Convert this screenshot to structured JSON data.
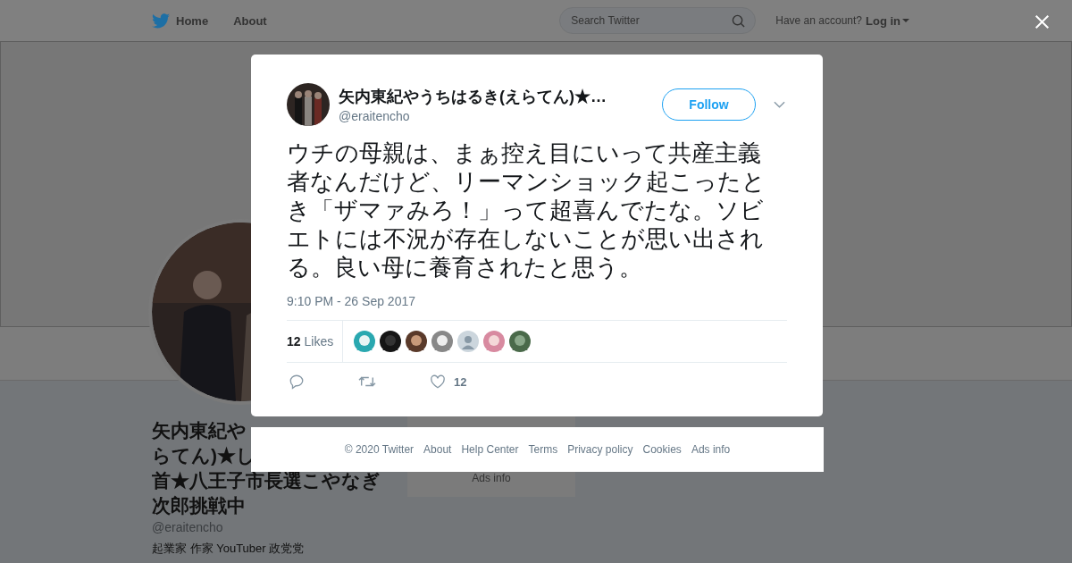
{
  "topbar": {
    "nav": [
      {
        "label": "Home"
      },
      {
        "label": "About"
      }
    ],
    "search": {
      "placeholder": "Search Twitter"
    },
    "account_prompt": "Have an account?",
    "login": "Log in"
  },
  "profile": {
    "name_lines": [
      "矢内東紀や",
      "らてん)★し",
      "首★八王子市長選こやなぎ",
      "次郎挑戦中"
    ],
    "handle": "@eraitencho",
    "bio": "起業家 作家 YouTuber 政党党"
  },
  "side_card": {
    "link": "Ads info"
  },
  "tweet": {
    "author": "矢内東紀やうちはるき(えらてん)★…",
    "handle": "@eraitencho",
    "follow": "Follow",
    "text": "ウチの母親は、まぁ控え目にいって共産主義者なんだけど、リーマンショック起こったとき「ザマァみろ！」って超喜んでたな。ソビエトには不況が存在しないことが思い出される。良い母に養育されたと思う。",
    "time": "9:10 PM - 26 Sep 2017",
    "likes_count": "12",
    "likes_label": "Likes",
    "likers": [
      {
        "kind": "picture"
      },
      {
        "kind": "picture"
      },
      {
        "kind": "picture"
      },
      {
        "kind": "picture"
      },
      {
        "kind": "default"
      },
      {
        "kind": "picture"
      },
      {
        "kind": "picture"
      }
    ],
    "like_total": "12"
  },
  "footer": [
    "© 2020 Twitter",
    "About",
    "Help Center",
    "Terms",
    "Privacy policy",
    "Cookies",
    "Ads info"
  ]
}
